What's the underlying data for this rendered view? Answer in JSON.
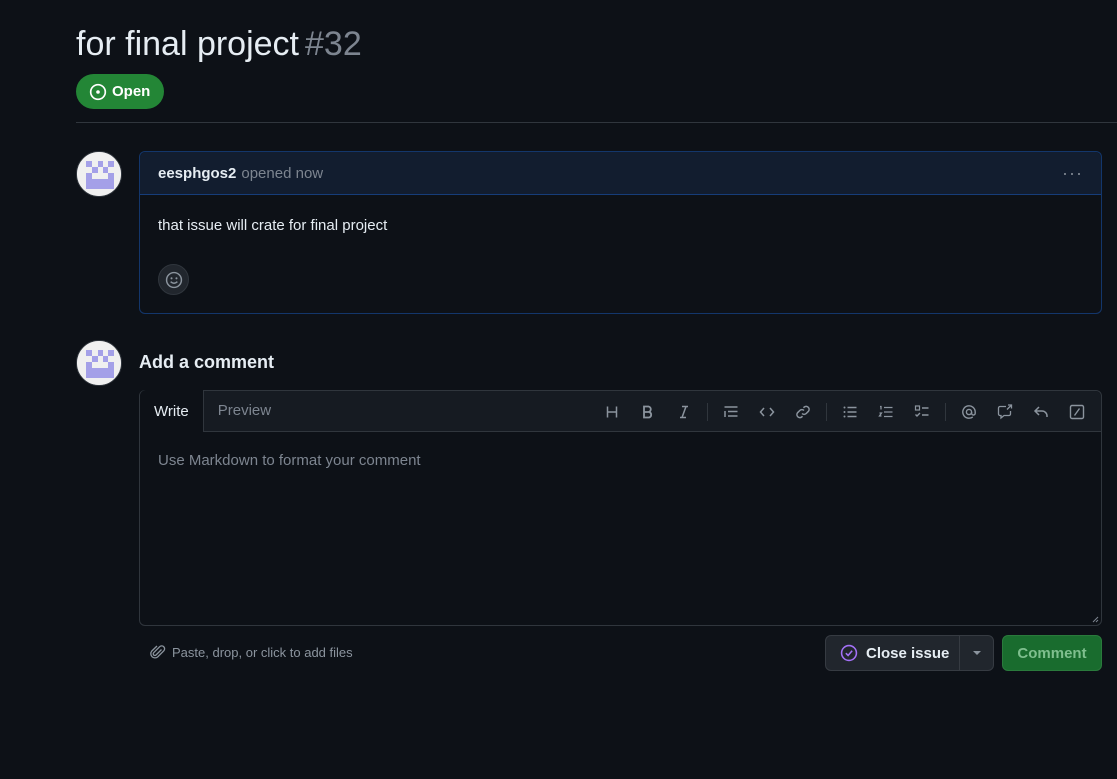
{
  "issue": {
    "title": "for final project",
    "number": "#32",
    "state_label": "Open",
    "state_color": "#238636"
  },
  "comment": {
    "author": "eesphgos2",
    "meta": "opened now",
    "menu_label": "···",
    "body": "that issue will crate for final project",
    "reaction_icon": "smiley-icon"
  },
  "new_comment": {
    "heading": "Add a comment",
    "tabs": [
      "Write",
      "Preview"
    ],
    "toolbar_icons": [
      "heading-icon",
      "bold-icon",
      "italic-icon",
      "quote-icon",
      "code-icon",
      "link-icon",
      "unordered-list-icon",
      "ordered-list-icon",
      "task-list-icon",
      "mention-icon",
      "cross-reference-icon",
      "saved-reply-icon",
      "slash-command-icon"
    ],
    "placeholder": "Use Markdown to format your comment",
    "attach_label": "Paste, drop, or click to add files",
    "close_label": "Close issue",
    "comment_label": "Comment"
  },
  "colors": {
    "accent_purple": "#a371f7",
    "primary_green": "#238636"
  }
}
